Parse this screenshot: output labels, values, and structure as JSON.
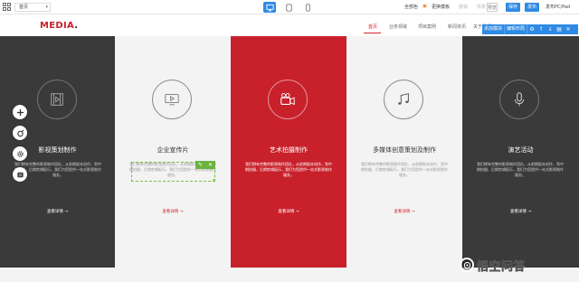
{
  "editor": {
    "page_select": "首页",
    "right_items": [
      "全部色",
      "更换模板"
    ],
    "disabled_items": [
      "撤销",
      "恢复"
    ],
    "preview_label": "预览",
    "save_label": "保存",
    "publish_label": "发布",
    "publish_pc_label": "发布PC/Pad",
    "accent": "#2f8ae5"
  },
  "site": {
    "logo": "MEDIA",
    "logo_dot": ".",
    "nav": [
      "首页",
      "业务领域",
      "项目案例",
      "新闻资讯",
      "关于我们"
    ],
    "brand_red": "#c8212b"
  },
  "section_toolbar": {
    "labels": [
      "添加模块",
      "编辑布局"
    ],
    "icons": [
      "gear-icon",
      "arrow-up-icon",
      "arrow-down-icon",
      "trash-icon",
      "close-icon"
    ]
  },
  "services": [
    {
      "title": "影视策划制作",
      "desc": "我们拥有完整的影视制作团队，从前期剧本创作，到中期拍摄，后期剪辑配乐，我们为您提供一站式影视制作服务。",
      "more": "查看详情 →",
      "icon": "film-icon"
    },
    {
      "title": "企业宣传片",
      "desc": "我们拥有完整的影视制作团队，从前期剧本创作，到中期拍摄，后期剪辑配乐，我们为您提供一站式影视制作服务。",
      "more": "查看详情 →",
      "icon": "play-screen-icon"
    },
    {
      "title": "艺术拍摄制作",
      "desc": "我们拥有完整的影视制作团队，从前期剧本创作，到中期拍摄，后期剪辑配乐，我们为您提供一站式影视制作服务。",
      "more": "查看详情 →",
      "icon": "video-camera-icon"
    },
    {
      "title": "多媒体创意策划及制作",
      "desc": "我们拥有完整的影视制作团队，从前期剧本创作，到中期拍摄，后期剪辑配乐，我们为您提供一站式影视制作服务。",
      "more": "查看详情 →",
      "icon": "music-note-icon"
    },
    {
      "title": "演艺活动",
      "desc": "我们拥有完整的影视制作团队，从前期剧本创作，到中期拍摄，后期剪辑配乐，我们为您提供一站式影视制作服务。",
      "more": "查看详情 →",
      "icon": "microphone-icon"
    }
  ],
  "side_tools": [
    "add-icon",
    "theme-icon",
    "settings-icon",
    "layers-icon"
  ],
  "watermark": "悟空问答"
}
